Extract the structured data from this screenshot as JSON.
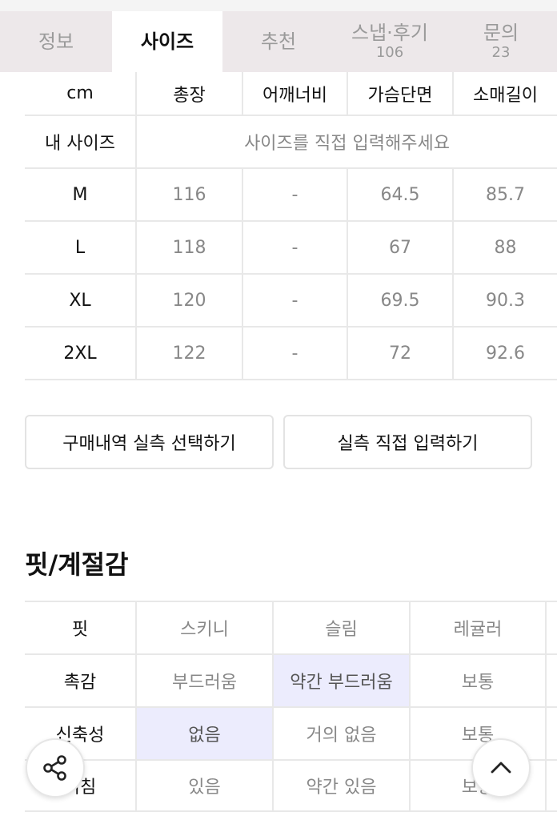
{
  "tabs": [
    {
      "label": "정보",
      "count": ""
    },
    {
      "label": "사이즈",
      "count": ""
    },
    {
      "label": "추천",
      "count": ""
    },
    {
      "label": "스냅·후기",
      "count": "106"
    },
    {
      "label": "문의",
      "count": "23"
    }
  ],
  "active_tab": "사이즈",
  "size_table": {
    "headers": [
      "cm",
      "총장",
      "어깨너비",
      "가슴단면",
      "소매길이"
    ],
    "my_size_label": "내 사이즈",
    "my_size_prompt": "사이즈를 직접 입력해주세요",
    "rows": [
      [
        "M",
        "116",
        "-",
        "64.5",
        "85.7"
      ],
      [
        "L",
        "118",
        "-",
        "67",
        "88"
      ],
      [
        "XL",
        "120",
        "-",
        "69.5",
        "90.3"
      ],
      [
        "2XL",
        "122",
        "-",
        "72",
        "92.6"
      ]
    ]
  },
  "buttons": {
    "purchase_history": "구매내역 실측 선택하기",
    "direct_input": "실측 직접 입력하기"
  },
  "fit_section": {
    "title": "핏/계절감",
    "rows": [
      {
        "label": "핏",
        "options": [
          "스키니",
          "슬림",
          "레귤러"
        ],
        "selected": null
      },
      {
        "label": "촉감",
        "options": [
          "부드러움",
          "약간 부드러움",
          "보통"
        ],
        "selected": 1
      },
      {
        "label": "신축성",
        "options": [
          "없음",
          "거의 없음",
          "보통"
        ],
        "selected": 0
      },
      {
        "label": "비침",
        "options": [
          "있음",
          "약간 있음",
          "보통"
        ],
        "selected": null
      }
    ]
  },
  "icons": {
    "share": "share-icon",
    "scroll_top": "chevron-up-icon"
  },
  "colors": {
    "selected_bg": "#ececfd",
    "tab_bar_bg": "#ede8ea"
  }
}
